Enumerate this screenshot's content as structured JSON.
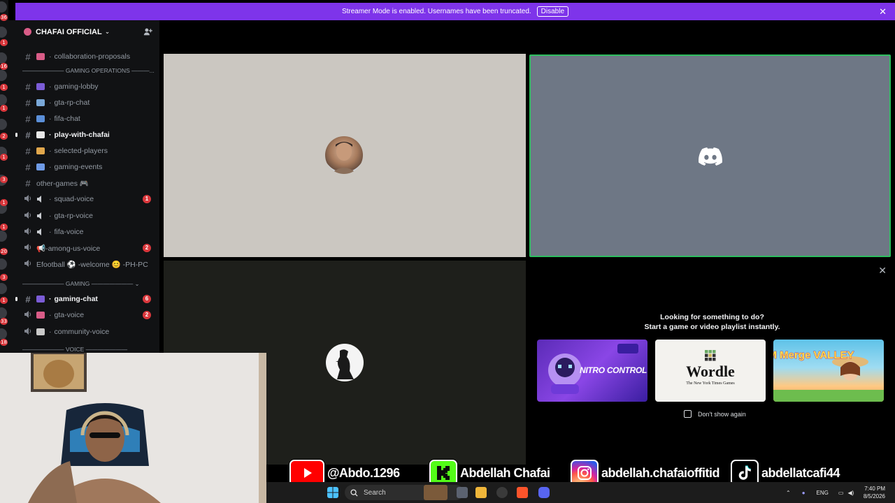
{
  "banner": {
    "text": "Streamer Mode is enabled. Usernames have been truncated.",
    "disable_label": "Disable",
    "close_glyph": "✕"
  },
  "server": {
    "name": "CHAFAI OFFICIAL",
    "chevron": "⌄"
  },
  "channels": [
    {
      "type": "text",
      "emoji_color": "#d95c87",
      "label": "collaboration-proposals"
    },
    {
      "type": "category",
      "label": "——————— GAMING OPERATIONS ———..."
    },
    {
      "type": "text",
      "emoji_color": "#7b5cd6",
      "label": "gaming-lobby"
    },
    {
      "type": "text",
      "emoji_color": "#7aa8d8",
      "label": "gta-rp-chat"
    },
    {
      "type": "text",
      "emoji_color": "#5b8fd9",
      "label": "fifa-chat"
    },
    {
      "type": "text",
      "emoji_color": "#e8e8e8",
      "label": "play-with-chafai",
      "bold": true
    },
    {
      "type": "text",
      "emoji_color": "#e0a74c",
      "label": "selected-players"
    },
    {
      "type": "text",
      "emoji_color": "#6f9be6",
      "label": "gaming-events"
    },
    {
      "type": "text-plain",
      "label": "other-games 🎮"
    },
    {
      "type": "voice",
      "label": "squad-voice",
      "badge": "1"
    },
    {
      "type": "voice",
      "label": "gta-rp-voice"
    },
    {
      "type": "voice",
      "label": "fifa-voice"
    },
    {
      "type": "voice-plain",
      "label": "📢-among-us-voice",
      "badge": "2"
    },
    {
      "type": "voice-plain",
      "label": "Efootball ⚽ -welcome 😊 -PH-PC"
    },
    {
      "type": "category",
      "label": "——————— GAMING ——————— ⌄"
    },
    {
      "type": "text",
      "emoji_color": "#7b5cd6",
      "label": "gaming-chat",
      "bold": true,
      "badge": "6"
    },
    {
      "type": "voice-emo",
      "emoji_color": "#d95c87",
      "label": "gta-voice",
      "badge": "2"
    },
    {
      "type": "voice-emo",
      "emoji_color": "#c9c9c9",
      "label": "community-voice"
    },
    {
      "type": "category",
      "label": "——————— VOICE ———————"
    }
  ],
  "rail_badges": [
    "36",
    "1",
    "16",
    "1",
    "1",
    "2",
    "1",
    "3",
    "1",
    "1",
    "20",
    "3",
    "1",
    "33",
    "18"
  ],
  "activity": {
    "title_line1": "Looking for something to do?",
    "title_line2": "Start a game or video playlist instantly.",
    "cards": [
      {
        "name": "NITRO CONTROL"
      },
      {
        "name": "Wordle",
        "subtitle": "The New York Times Games"
      },
      {
        "name": "FARM Merge VALLEY"
      }
    ],
    "dont_show_label": "Don't show again",
    "close_glyph": "✕"
  },
  "social": {
    "youtube": "@Abdo.1296",
    "kick": "Abdellah Chafai",
    "instagram": "abdellah.chafaioffitid",
    "tiktok": "abdellatcafi44"
  },
  "taskbar": {
    "search_label": "Search",
    "lang": "ENG",
    "time": "7:40 PM",
    "date": "8/5/2026"
  },
  "colors": {
    "banner": "#7e34ea",
    "speaking_border": "#2dbe5f",
    "badge": "#da373c"
  }
}
